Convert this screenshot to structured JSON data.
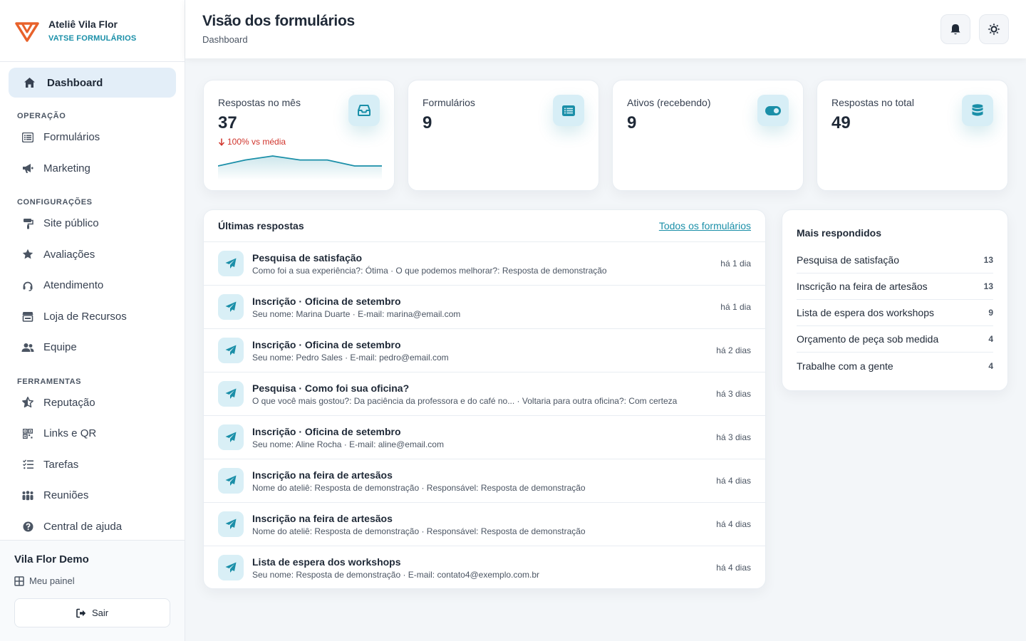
{
  "brand": {
    "name": "Ateliê Vila Flor",
    "subtitle": "VATSE FORMULÁRIOS"
  },
  "colors": {
    "accent": "#1a8fa8",
    "brand_orange": "#e8622b",
    "delta_down": "#d0342c"
  },
  "sidebar": {
    "active": {
      "label": "Dashboard",
      "icon": "home-icon"
    },
    "sections": [
      {
        "title": "OPERAÇÃO",
        "items": [
          {
            "label": "Formulários",
            "icon": "list-icon"
          },
          {
            "label": "Marketing",
            "icon": "megaphone-icon"
          }
        ]
      },
      {
        "title": "CONFIGURAÇÕES",
        "items": [
          {
            "label": "Site público",
            "icon": "paint-roller-icon"
          },
          {
            "label": "Avaliações",
            "icon": "star-icon"
          },
          {
            "label": "Atendimento",
            "icon": "headset-icon"
          },
          {
            "label": "Loja de Recursos",
            "icon": "store-icon"
          },
          {
            "label": "Equipe",
            "icon": "users-icon"
          }
        ]
      },
      {
        "title": "FERRAMENTAS",
        "items": [
          {
            "label": "Reputação",
            "icon": "star-half-icon"
          },
          {
            "label": "Links e QR",
            "icon": "qr-icon"
          },
          {
            "label": "Tarefas",
            "icon": "checklist-icon"
          },
          {
            "label": "Reuniões",
            "icon": "people-group-icon"
          },
          {
            "label": "Central de ajuda",
            "icon": "help-icon"
          }
        ]
      }
    ],
    "footer": {
      "user": "Vila Flor Demo",
      "panel_link": "Meu painel",
      "logout": "Sair"
    }
  },
  "header": {
    "title": "Visão dos formulários",
    "subtitle": "Dashboard"
  },
  "stats": [
    {
      "label": "Respostas no mês",
      "value": "37",
      "icon": "inbox-icon",
      "delta": "100% vs média"
    },
    {
      "label": "Formulários",
      "value": "9",
      "icon": "list-icon"
    },
    {
      "label": "Ativos (recebendo)",
      "value": "9",
      "icon": "toggle-icon"
    },
    {
      "label": "Respostas no total",
      "value": "49",
      "icon": "database-icon"
    }
  ],
  "sparkline": {
    "values": [
      5,
      8,
      10,
      8,
      8,
      5,
      5
    ]
  },
  "latest": {
    "title": "Últimas respostas",
    "link": "Todos os formulários",
    "rows": [
      {
        "title": "Pesquisa de satisfação",
        "detail": "Como foi a sua experiência?: Ótima · O que podemos melhorar?: Resposta de demonstração",
        "time": "há 1 dia"
      },
      {
        "title": "Inscrição · Oficina de setembro",
        "detail": "Seu nome: Marina Duarte · E-mail: marina@email.com",
        "time": "há 1 dia"
      },
      {
        "title": "Inscrição · Oficina de setembro",
        "detail": "Seu nome: Pedro Sales · E-mail: pedro@email.com",
        "time": "há 2 dias"
      },
      {
        "title": "Pesquisa · Como foi sua oficina?",
        "detail": "O que você mais gostou?: Da paciência da professora e do café no... · Voltaria para outra oficina?: Com certeza",
        "time": "há 3 dias"
      },
      {
        "title": "Inscrição · Oficina de setembro",
        "detail": "Seu nome: Aline Rocha · E-mail: aline@email.com",
        "time": "há 3 dias"
      },
      {
        "title": "Inscrição na feira de artesãos",
        "detail": "Nome do ateliê: Resposta de demonstração · Responsável: Resposta de demonstração",
        "time": "há 4 dias"
      },
      {
        "title": "Inscrição na feira de artesãos",
        "detail": "Nome do ateliê: Resposta de demonstração · Responsável: Resposta de demonstração",
        "time": "há 4 dias"
      },
      {
        "title": "Lista de espera dos workshops",
        "detail": "Seu nome: Resposta de demonstração · E-mail: contato4@exemplo.com.br",
        "time": "há 4 dias"
      }
    ]
  },
  "top": {
    "title": "Mais respondidos",
    "rows": [
      {
        "name": "Pesquisa de satisfação",
        "count": "13"
      },
      {
        "name": "Inscrição na feira de artesãos",
        "count": "13"
      },
      {
        "name": "Lista de espera dos workshops",
        "count": "9"
      },
      {
        "name": "Orçamento de peça sob medida",
        "count": "4"
      },
      {
        "name": "Trabalhe com a gente",
        "count": "4"
      }
    ]
  }
}
